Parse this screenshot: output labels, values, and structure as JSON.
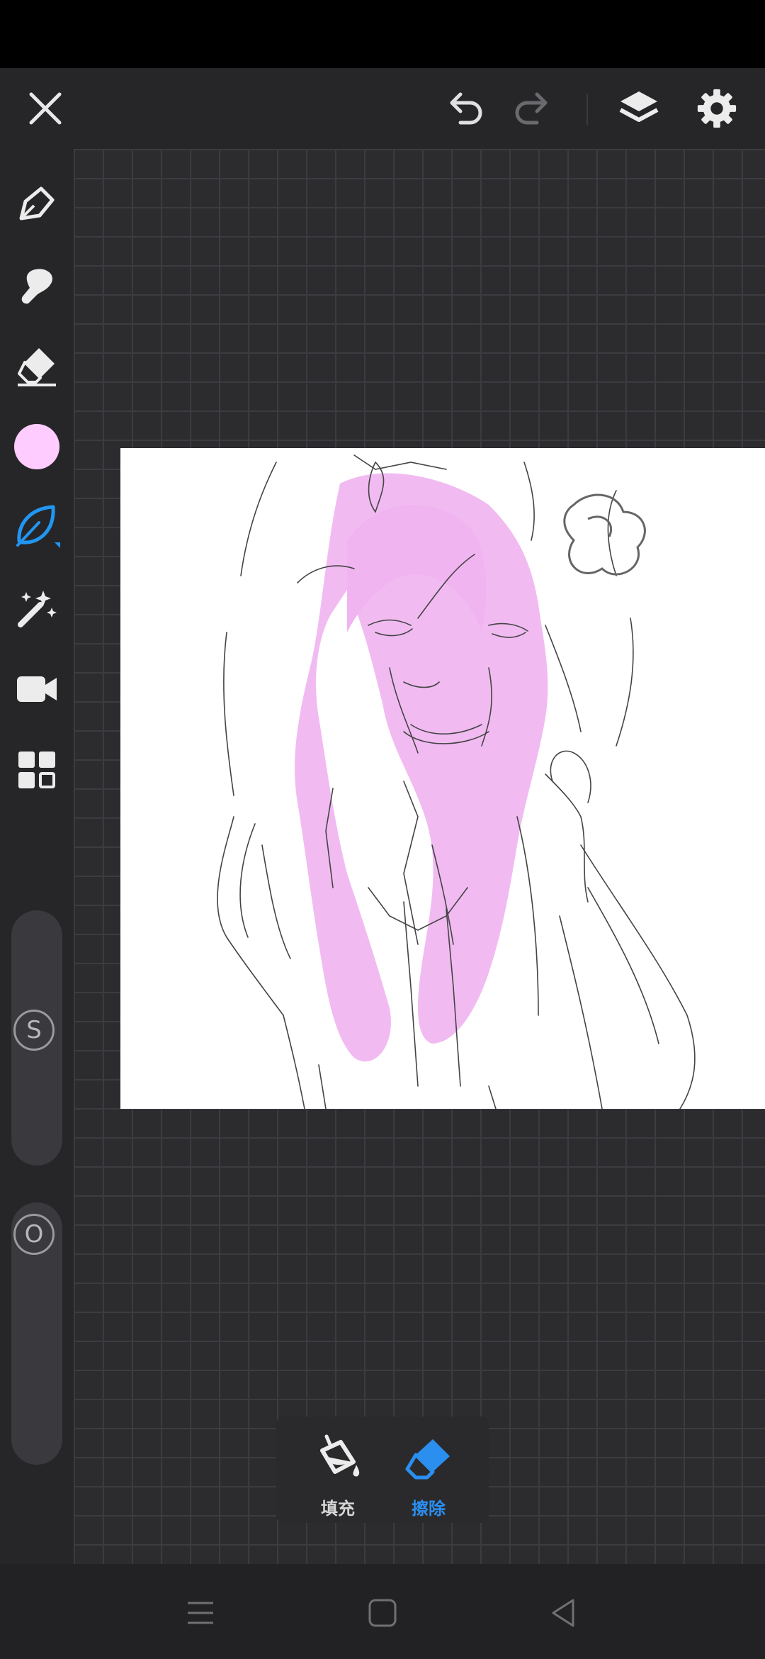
{
  "app": {
    "top_bar": {
      "close": "close-icon",
      "undo": "undo-icon",
      "redo": "redo-icon",
      "layers": "layers-icon",
      "settings": "gear-icon"
    },
    "left_toolbar": {
      "tools": [
        "pen-icon",
        "smudge-icon",
        "eraser-icon",
        "color-swatch",
        "brush-leaf-icon",
        "magic-wand-icon",
        "video-camera-icon",
        "grid-menu-icon"
      ],
      "current_color": "#ffccff",
      "active_tool_color": "#2196f3",
      "size_slider_label": "S",
      "opacity_slider_label": "O"
    },
    "fill_popup": {
      "fill_label": "填充",
      "erase_label": "擦除",
      "active": "erase",
      "active_color": "#2b8ff0"
    },
    "nav_bar": {
      "items": [
        "menu-icon",
        "home-icon",
        "back-icon"
      ]
    }
  }
}
